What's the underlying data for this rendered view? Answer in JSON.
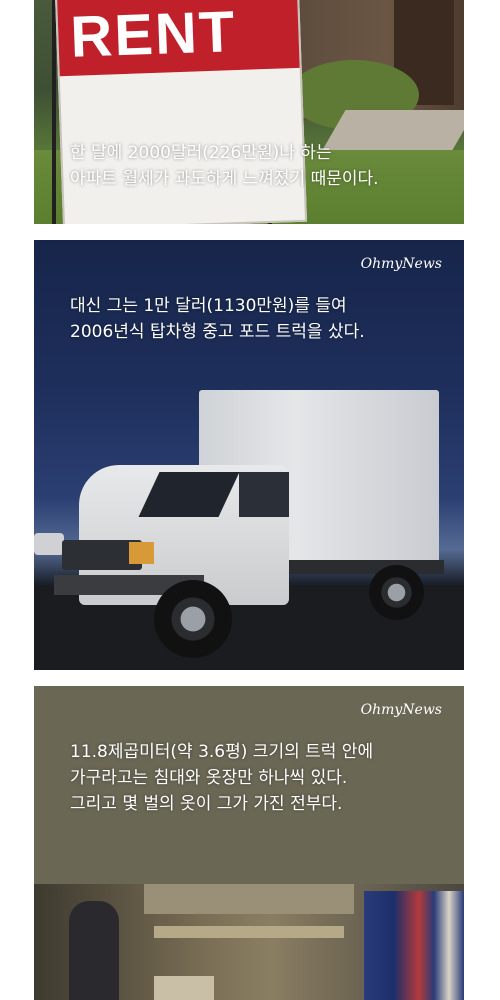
{
  "cards": [
    {
      "sign_word": "RENT",
      "caption": [
        "한 달에 2000달러(226만원)나 하는",
        "아파트 월세가 과도하게 느껴졌기 때문이다."
      ]
    },
    {
      "logo": "OhmyNews",
      "caption": [
        "대신 그는 1만 달러(1130만원)를 들여",
        "2006년식 탑차형 중고 포드 트럭을 샀다."
      ]
    },
    {
      "logo": "OhmyNews",
      "caption": [
        "11.8제곱미터(약 3.6평) 크기의 트럭 안에",
        "가구라고는 침대와 옷장만 하나씩 있다.",
        "그리고 몇 벌의 옷이 그가 가진 전부다."
      ]
    }
  ],
  "colors": {
    "sign_red": "#c0202a",
    "night_sky": "#1e2f5c",
    "olive_panel": "#6b6755"
  }
}
